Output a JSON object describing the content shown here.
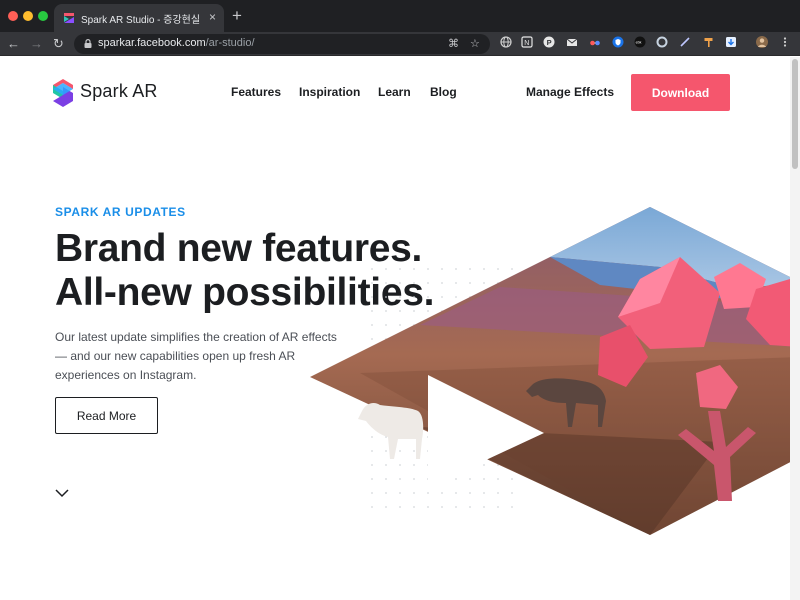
{
  "browser": {
    "tab_title": "Spark AR Studio - 증강현실 경험",
    "tab_close": "×",
    "new_tab": "+",
    "url_host": "sparkar.facebook.com",
    "url_path": "/ar-studio/"
  },
  "header": {
    "brand": "Spark AR",
    "nav": [
      "Features",
      "Inspiration",
      "Learn",
      "Blog"
    ],
    "manage_effects": "Manage Effects",
    "download": "Download"
  },
  "hero": {
    "kicker": "SPARK AR UPDATES",
    "headline_line1": "Brand new features.",
    "headline_line2": "All-new possibilities.",
    "description": "Our latest update simplifies the creation of AR effects — and our new capabilities open up fresh AR experiences on Instagram.",
    "read_more": "Read More"
  },
  "colors": {
    "accent": "#f5566d",
    "kicker": "#1a8ee8",
    "tabbar": "#1f2023",
    "toolbar": "#35363a"
  },
  "icons": {
    "nav": [
      "back-icon",
      "forward-icon",
      "reload-icon"
    ],
    "omnibox": [
      "lock-icon",
      "translate-icon",
      "star-icon"
    ],
    "extensions": [
      "globe-icon",
      "notion-icon",
      "pinterest-icon",
      "mail-icon",
      "glasses-icon",
      "shield-icon",
      "ebook-icon",
      "circle-icon",
      "pen-icon",
      "hammer-icon",
      "download-icon",
      "avatar-icon",
      "more-icon"
    ],
    "page": [
      "spark-ar-logo-icon",
      "chevron-down-icon",
      "play-icon"
    ]
  }
}
